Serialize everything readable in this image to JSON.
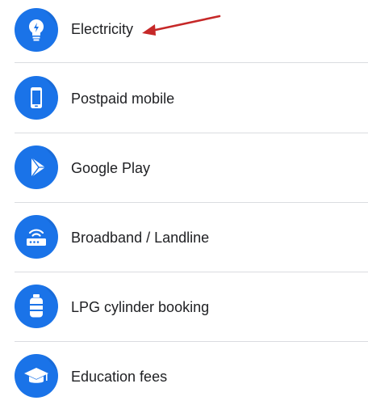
{
  "services": [
    {
      "label": "Electricity",
      "icon": "lightbulb-icon"
    },
    {
      "label": "Postpaid mobile",
      "icon": "mobile-phone-icon"
    },
    {
      "label": "Google Play",
      "icon": "google-play-icon"
    },
    {
      "label": "Broadband / Landline",
      "icon": "router-icon"
    },
    {
      "label": "LPG cylinder booking",
      "icon": "gas-cylinder-icon"
    },
    {
      "label": "Education fees",
      "icon": "graduation-cap-icon"
    }
  ],
  "colors": {
    "icon_background": "#1a73e8",
    "divider": "#dadce0",
    "text": "#202124",
    "annotation_arrow": "#c62828"
  }
}
